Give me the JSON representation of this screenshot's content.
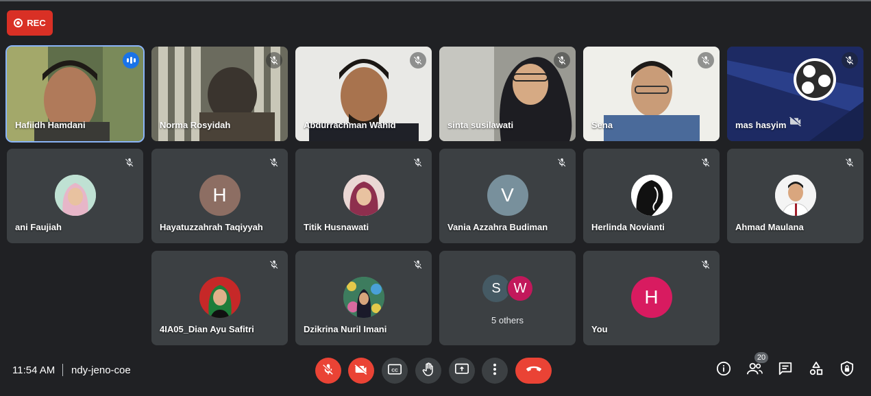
{
  "recording": {
    "label": "REC"
  },
  "participants_video": [
    {
      "name": "Hafiidh Hamdani"
    },
    {
      "name": "Norma Rosyidah"
    },
    {
      "name": "Abdurrachman Wahid"
    },
    {
      "name": "sinta susilawati"
    },
    {
      "name": "Sena"
    },
    {
      "name": "mas hasyim"
    }
  ],
  "participants_row2": [
    {
      "name": "ani Faujiah"
    },
    {
      "name": "Hayatuzzahrah Taqiyyah",
      "initial": "H",
      "color": "#8d6e63"
    },
    {
      "name": "Titik Husnawati"
    },
    {
      "name": "Vania Azzahra Budiman",
      "initial": "V",
      "color": "#78909c"
    },
    {
      "name": "Herlinda Novianti"
    },
    {
      "name": "Ahmad Maulana"
    }
  ],
  "participants_row3": [
    {
      "name": "4IA05_Dian Ayu Safitri"
    },
    {
      "name": "Dzikrina Nuril Imani"
    },
    {
      "others_label": "5 others",
      "avatars": [
        {
          "initial": "S",
          "color": "#455a64"
        },
        {
          "initial": "W",
          "color": "#c2185b"
        }
      ]
    },
    {
      "name": "You",
      "initial": "H",
      "color": "#d81b60"
    }
  ],
  "footer": {
    "time": "11:54 AM",
    "meeting_code": "ndy-jeno-coe",
    "participants_count": "20"
  },
  "controls": [
    {
      "name": "mic-off",
      "state": "off"
    },
    {
      "name": "camera-off",
      "state": "off"
    },
    {
      "name": "captions"
    },
    {
      "name": "raise-hand"
    },
    {
      "name": "present"
    },
    {
      "name": "more-options"
    },
    {
      "name": "leave-call"
    }
  ],
  "colors": {
    "background": "#202124",
    "tile": "#3c4043",
    "danger": "#ea4335",
    "active_speaker": "#1a73e8"
  }
}
